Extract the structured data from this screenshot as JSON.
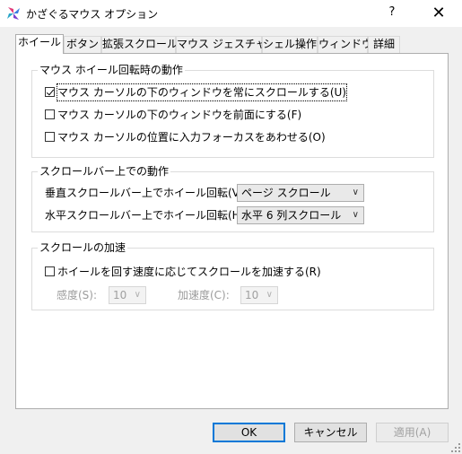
{
  "window": {
    "title": "かざぐるマウス オプション",
    "help_label": "?",
    "close_label": "✕"
  },
  "tabs": [
    {
      "label": "ホイール"
    },
    {
      "label": "ボタン"
    },
    {
      "label": "拡張スクロール"
    },
    {
      "label": "マウス ジェスチャー"
    },
    {
      "label": "シェル操作"
    },
    {
      "label": "ウィンドウ"
    },
    {
      "label": "詳細"
    }
  ],
  "wheel_group": {
    "title": "マウス ホイール回転時の動作",
    "options": [
      {
        "label": "マウス カーソルの下のウィンドウを常にスクロールする(U)",
        "checked": true
      },
      {
        "label": "マウス カーソルの下のウィンドウを前面にする(F)",
        "checked": false
      },
      {
        "label": "マウス カーソルの位置に入力フォーカスをあわせる(O)",
        "checked": false
      }
    ]
  },
  "scrollbar_group": {
    "title": "スクロールバー上での動作",
    "vertical_label": "垂直スクロールバー上でホイール回転(V):",
    "vertical_value": "ページ スクロール",
    "horizontal_label": "水平スクロールバー上でホイール回転(H):",
    "horizontal_value": "水平 6 列スクロール"
  },
  "accel_group": {
    "title": "スクロールの加速",
    "option_label": "ホイールを回す速度に応じてスクロールを加速する(R)",
    "option_checked": false,
    "sensitivity_label": "感度(S):",
    "sensitivity_value": "10",
    "acceleration_label": "加速度(C):",
    "acceleration_value": "10"
  },
  "buttons": {
    "ok": "OK",
    "cancel": "キャンセル",
    "apply": "適用(A)"
  }
}
